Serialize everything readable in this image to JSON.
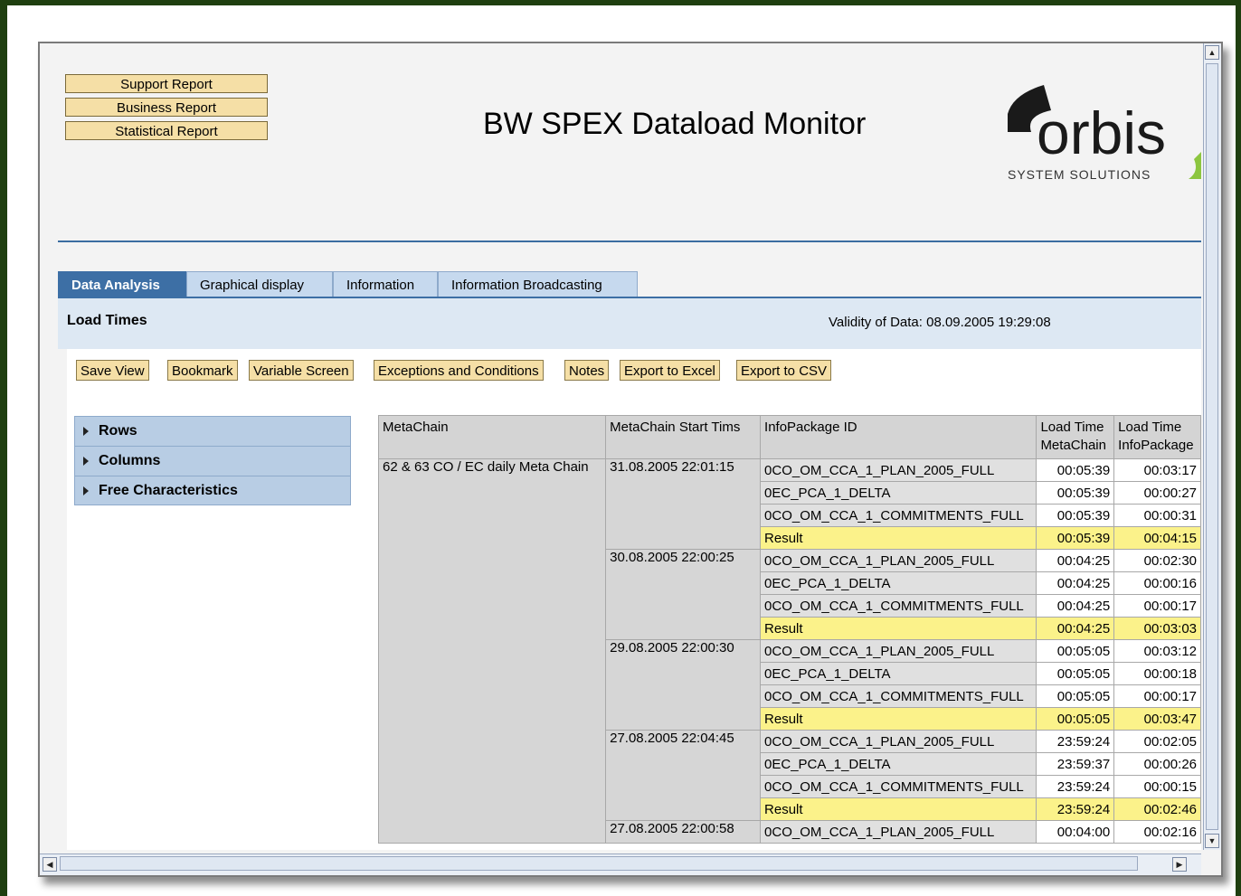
{
  "report_buttons": [
    "Support Report",
    "Business Report",
    "Statistical Report"
  ],
  "app_title": "BW SPEX Dataload Monitor",
  "logo": {
    "text": "orbis",
    "subtitle": "SYSTEM SOLUTIONS"
  },
  "tabs": [
    {
      "label": "Data Analysis",
      "active": true
    },
    {
      "label": "Graphical display",
      "active": false
    },
    {
      "label": "Information",
      "active": false
    },
    {
      "label": "Information Broadcasting",
      "active": false
    }
  ],
  "section": {
    "title": "Load Times",
    "validity": "Validity of Data: 08.09.2005 19:29:08"
  },
  "toolbar": [
    "Save View",
    "Bookmark",
    "Variable Screen",
    "Exceptions and Conditions",
    "Notes",
    "Export to Excel",
    "Export to CSV"
  ],
  "nav": [
    "Rows",
    "Columns",
    "Free Characteristics"
  ],
  "table": {
    "headers": [
      "MetaChain",
      "MetaChain Start Tims",
      "InfoPackage ID",
      "Load Time\nMetaChain",
      "Load Time\nInfoPackage"
    ],
    "metachain": "62 & 63 CO / EC daily Meta Chain",
    "groups": [
      {
        "start": "31.08.2005 22:01:15",
        "rows": [
          {
            "ip": "0CO_OM_CCA_1_PLAN_2005_FULL",
            "mc": "00:05:39",
            "ipt": "00:03:17"
          },
          {
            "ip": "0EC_PCA_1_DELTA",
            "mc": "00:05:39",
            "ipt": "00:00:27"
          },
          {
            "ip": "0CO_OM_CCA_1_COMMITMENTS_FULL",
            "mc": "00:05:39",
            "ipt": "00:00:31"
          },
          {
            "ip": "Result",
            "mc": "00:05:39",
            "ipt": "00:04:15",
            "result": true
          }
        ]
      },
      {
        "start": "30.08.2005 22:00:25",
        "rows": [
          {
            "ip": "0CO_OM_CCA_1_PLAN_2005_FULL",
            "mc": "00:04:25",
            "ipt": "00:02:30"
          },
          {
            "ip": "0EC_PCA_1_DELTA",
            "mc": "00:04:25",
            "ipt": "00:00:16"
          },
          {
            "ip": "0CO_OM_CCA_1_COMMITMENTS_FULL",
            "mc": "00:04:25",
            "ipt": "00:00:17"
          },
          {
            "ip": "Result",
            "mc": "00:04:25",
            "ipt": "00:03:03",
            "result": true
          }
        ]
      },
      {
        "start": "29.08.2005 22:00:30",
        "rows": [
          {
            "ip": "0CO_OM_CCA_1_PLAN_2005_FULL",
            "mc": "00:05:05",
            "ipt": "00:03:12"
          },
          {
            "ip": "0EC_PCA_1_DELTA",
            "mc": "00:05:05",
            "ipt": "00:00:18"
          },
          {
            "ip": "0CO_OM_CCA_1_COMMITMENTS_FULL",
            "mc": "00:05:05",
            "ipt": "00:00:17"
          },
          {
            "ip": "Result",
            "mc": "00:05:05",
            "ipt": "00:03:47",
            "result": true
          }
        ]
      },
      {
        "start": "27.08.2005 22:04:45",
        "rows": [
          {
            "ip": "0CO_OM_CCA_1_PLAN_2005_FULL",
            "mc": "23:59:24",
            "ipt": "00:02:05"
          },
          {
            "ip": "0EC_PCA_1_DELTA",
            "mc": "23:59:37",
            "ipt": "00:00:26"
          },
          {
            "ip": "0CO_OM_CCA_1_COMMITMENTS_FULL",
            "mc": "23:59:24",
            "ipt": "00:00:15"
          },
          {
            "ip": "Result",
            "mc": "23:59:24",
            "ipt": "00:02:46",
            "result": true
          }
        ]
      },
      {
        "start": "27.08.2005 22:00:58",
        "rows": [
          {
            "ip": "0CO_OM_CCA_1_PLAN_2005_FULL",
            "mc": "00:04:00",
            "ipt": "00:02:16"
          }
        ]
      }
    ]
  },
  "colors": {
    "button_bg": "#f5dfa6",
    "tab_active": "#3d6fa5",
    "result_row": "#fbf28a",
    "logo_green": "#8cc63f"
  }
}
